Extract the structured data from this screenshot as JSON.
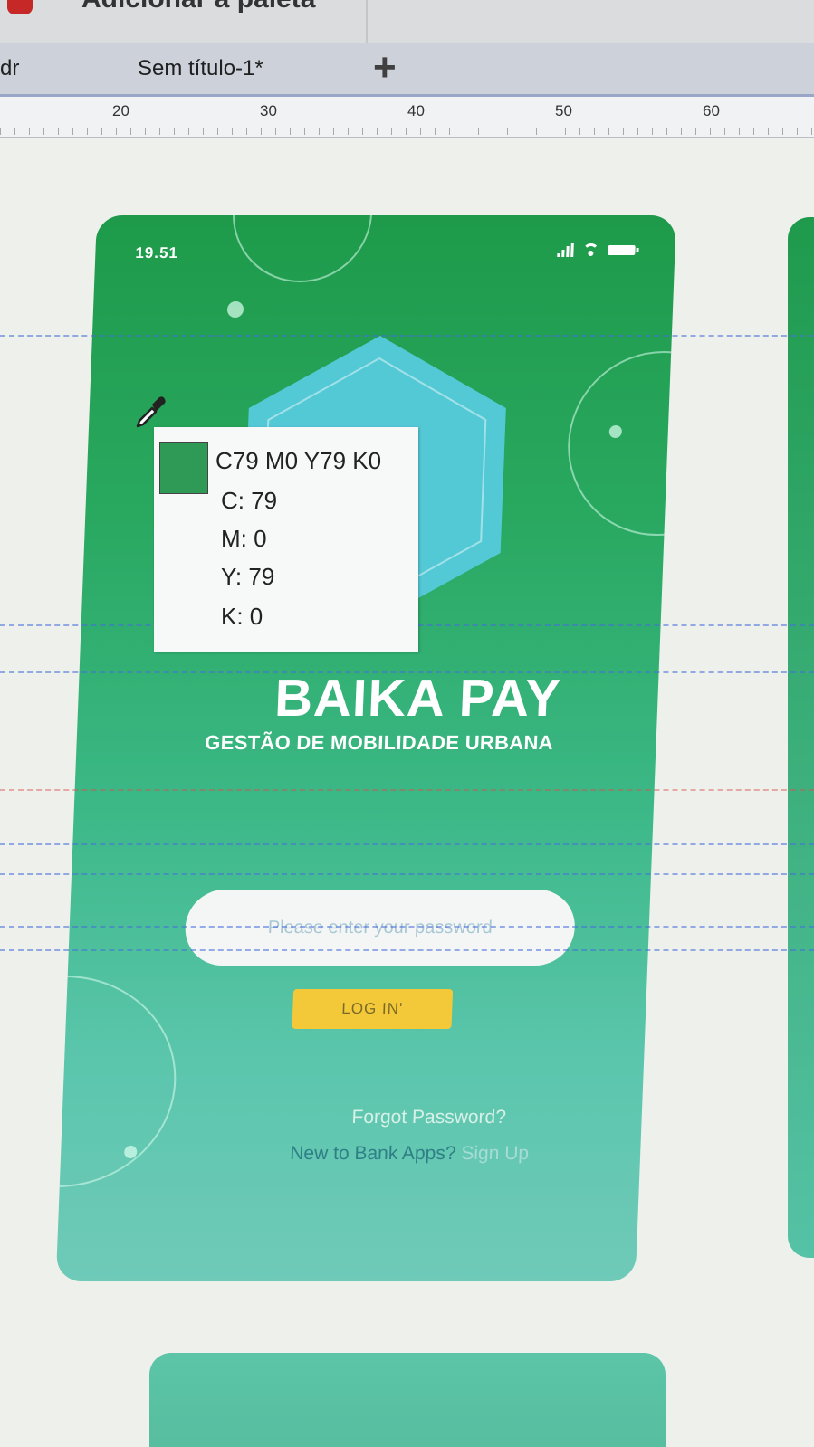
{
  "window": {
    "title_cut": "Adicionar à paleta"
  },
  "tabs": {
    "items": [
      "dr",
      "Sem título-1*"
    ],
    "add_label": "+"
  },
  "ruler": {
    "marks": [
      "20",
      "30",
      "40",
      "50",
      "60"
    ]
  },
  "phone": {
    "status_time": "19.51",
    "brand_title": "BAIKA PAY",
    "brand_subtitle": "GESTÃO DE MOBILIDADE URBANA",
    "password_placeholder": "Please enter your password",
    "login_label": "LOG IN'",
    "forgot_label": "Forgot Password?",
    "signup_prompt": "New to Bank Apps?",
    "signup_link": "Sign Up"
  },
  "color_tooltip": {
    "title": "C79 M0 Y79 K0",
    "c": "C: 79",
    "m": "M: 0",
    "y": "Y: 79",
    "k": "K: 0",
    "swatch_color": "#2f9a55"
  },
  "colors": {
    "phone_green": "#1e9a4a",
    "phone_teal": "#6fcab8",
    "login_yellow": "#f3c93a",
    "guide_blue": "#466edc"
  }
}
